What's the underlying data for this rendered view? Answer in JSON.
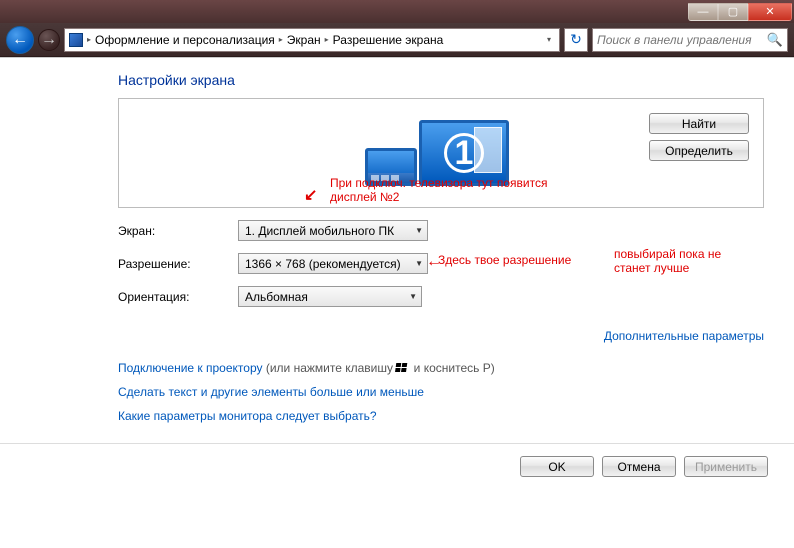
{
  "window_controls": {
    "min": "—",
    "max": "▢",
    "close": "✕"
  },
  "breadcrumbs": {
    "items": [
      "Оформление и персонализация",
      "Экран",
      "Разрешение экрана"
    ]
  },
  "search": {
    "placeholder": "Поиск в панели управления"
  },
  "page_title": "Настройки экрана",
  "preview": {
    "monitor_number": "1",
    "find_button": "Найти",
    "detect_button": "Определить"
  },
  "annotations": {
    "tv": "При подключ. телевизора тут появится дисплей №2",
    "res": "Здесь твое разрешение",
    "pick": "повыбирай пока не станет лучше"
  },
  "form": {
    "screen_label": "Экран:",
    "screen_value": "1. Дисплей мобильного ПК",
    "resolution_label": "Разрешение:",
    "resolution_value": "1366 × 768 (рекомендуется)",
    "orientation_label": "Ориентация:",
    "orientation_value": "Альбомная"
  },
  "advanced_link": "Дополнительные параметры",
  "links": {
    "projector": "Подключение к проектору",
    "projector_hint_pre": " (или нажмите клавишу ",
    "projector_hint_post": " и коснитесь P)",
    "text_size": "Сделать текст и другие элементы больше или меньше",
    "which_settings": "Какие параметры монитора следует выбрать?"
  },
  "footer": {
    "ok": "OK",
    "cancel": "Отмена",
    "apply": "Применить"
  }
}
